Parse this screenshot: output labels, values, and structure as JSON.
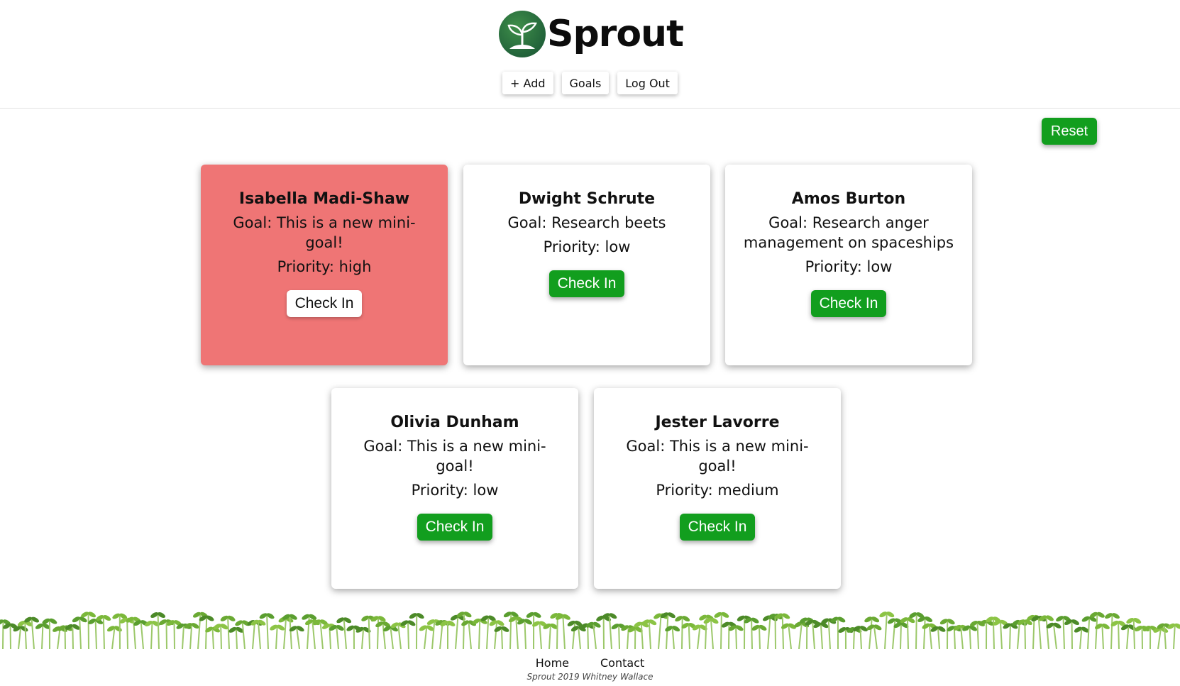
{
  "brand": {
    "name": "Sprout",
    "logo_icon": "sprout-icon"
  },
  "nav": {
    "add": "+ Add",
    "goals": "Goals",
    "logout": "Log Out"
  },
  "reset": "Reset",
  "cards": [
    {
      "name": "Isabella Madi-Shaw",
      "goal": "Goal: This is a new mini-goal!",
      "priority": "Priority: high",
      "button": "Check In",
      "highlight_color": "#ef7575"
    },
    {
      "name": "Dwight Schrute",
      "goal": "Goal: Research beets",
      "priority": "Priority: low",
      "button": "Check In"
    },
    {
      "name": "Amos Burton",
      "goal": "Goal: Research anger management on spaceships",
      "priority": "Priority: low",
      "button": "Check In"
    },
    {
      "name": "Olivia Dunham",
      "goal": "Goal: This is a new mini-goal!",
      "priority": "Priority: low",
      "button": "Check In"
    },
    {
      "name": "Jester Lavorre",
      "goal": "Goal: This is a new mini-goal!",
      "priority": "Priority: medium",
      "button": "Check In"
    }
  ],
  "footer": {
    "home": "Home",
    "contact": "Contact",
    "copyright": "Sprout 2019 Whitney Wallace"
  },
  "colors": {
    "accent": "#129e1e",
    "logo_green": "#2a6e3c"
  }
}
